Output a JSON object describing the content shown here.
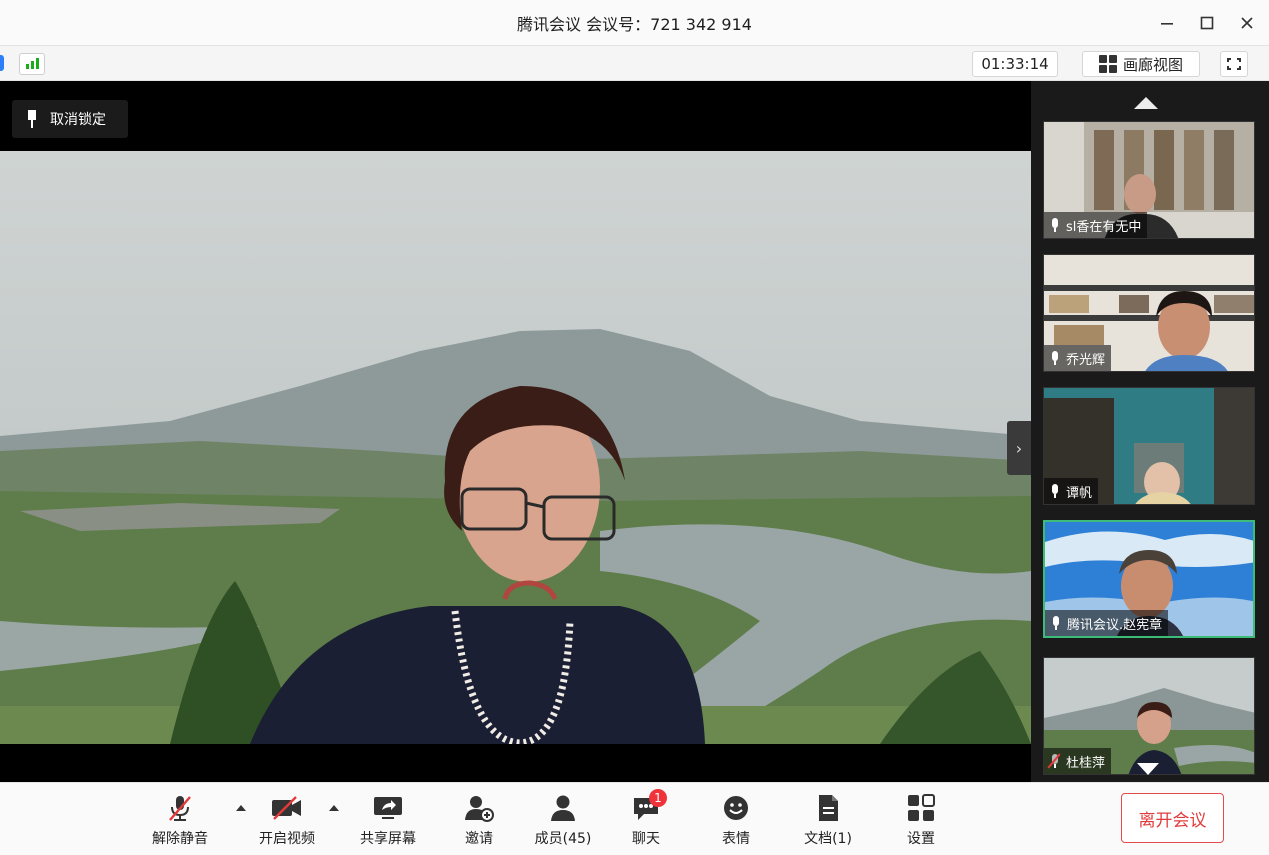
{
  "window": {
    "title": "腾讯会议 会议号：721 342 914",
    "minimize_icon": "minimize-icon",
    "maximize_icon": "maximize-icon",
    "close_icon": "close-icon"
  },
  "infobar": {
    "timer": "01:33:14",
    "gallery_view_label": "画廊视图",
    "signal_icon": "signal-bars-icon",
    "fullscreen_icon": "fullscreen-icon"
  },
  "main": {
    "unlock_label": "取消锁定",
    "speaker_video": "landscape-background-speaker"
  },
  "participants": [
    {
      "name": "sl香在有无中",
      "muted": false
    },
    {
      "name": "乔光辉",
      "muted": false
    },
    {
      "name": "谭帆",
      "muted": false
    },
    {
      "name": "腾讯会议.赵宪章",
      "muted": false,
      "active": true
    },
    {
      "name": "杜桂萍",
      "muted": true
    }
  ],
  "toolbar": {
    "unmute_label": "解除静音",
    "start_video_label": "开启视频",
    "share_screen_label": "共享屏幕",
    "invite_label": "邀请",
    "members_label": "成员(45)",
    "chat_label": "聊天",
    "chat_badge": "1",
    "reactions_label": "表情",
    "docs_label": "文档(1)",
    "settings_label": "设置",
    "leave_label": "离开会议"
  },
  "colors": {
    "accent_green": "#1aad19",
    "leave_red": "#e03c3c",
    "badge_red": "#f0333b",
    "active_tile_border": "#3dbb78"
  }
}
